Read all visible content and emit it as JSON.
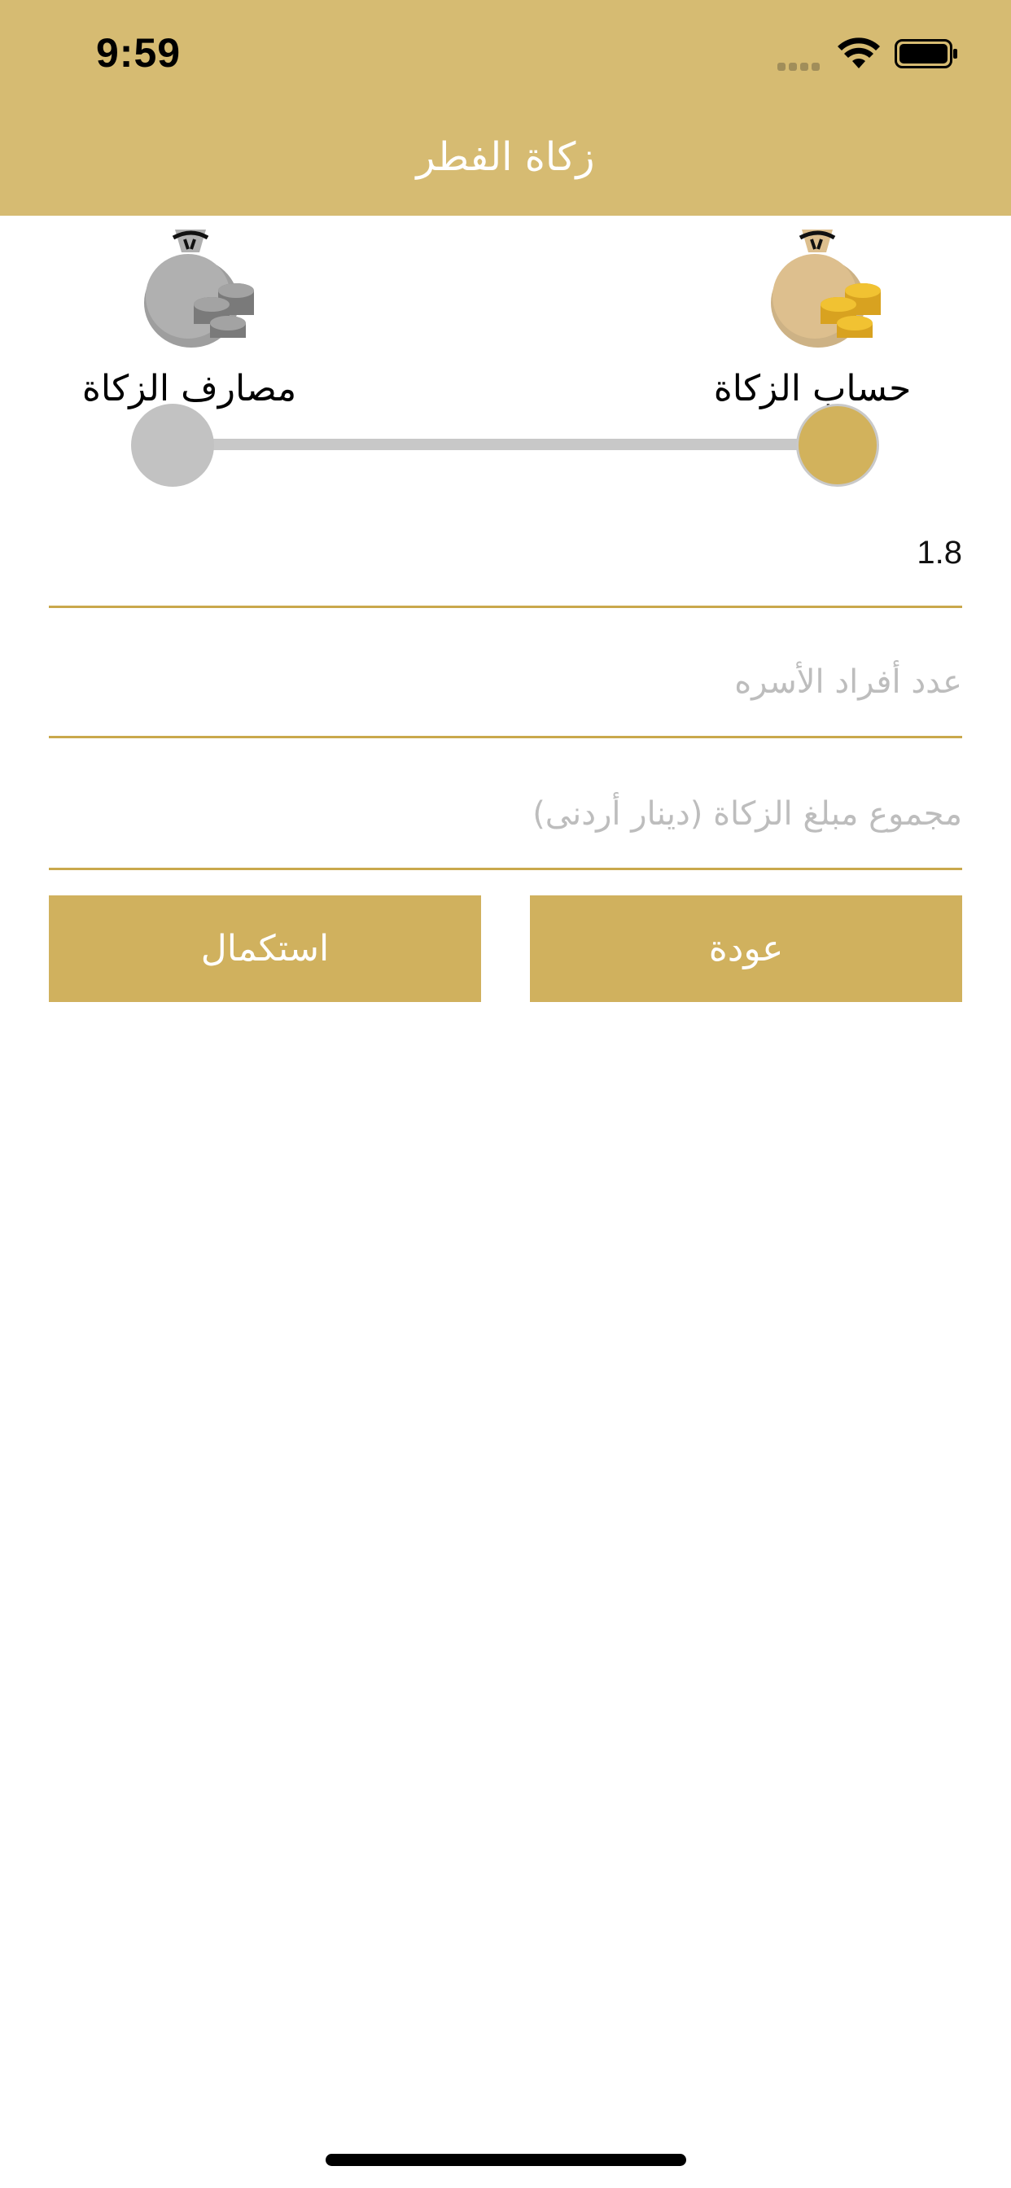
{
  "status_bar": {
    "time": "9:59"
  },
  "nav": {
    "title": "زكاة الفطر"
  },
  "steps": [
    {
      "label": "حساب الزكاة",
      "state": "active",
      "icon": "money-bag-gold-icon"
    },
    {
      "label": "مصارف الزكاة",
      "state": "inactive",
      "icon": "money-bag-gray-icon"
    }
  ],
  "progress": {
    "current_step": 1,
    "total_steps": 2
  },
  "form": {
    "value_text": "1.8",
    "family_placeholder": "عدد أفراد الأسره",
    "total_placeholder": "مجموع مبلغ الزكاة (دينار أردنى)"
  },
  "buttons": {
    "back_label": "عودة",
    "next_label": "استكمال"
  },
  "colors": {
    "header": "#d6bb72",
    "accent": "#d0b15e",
    "inactive": "#c2c2c2"
  }
}
